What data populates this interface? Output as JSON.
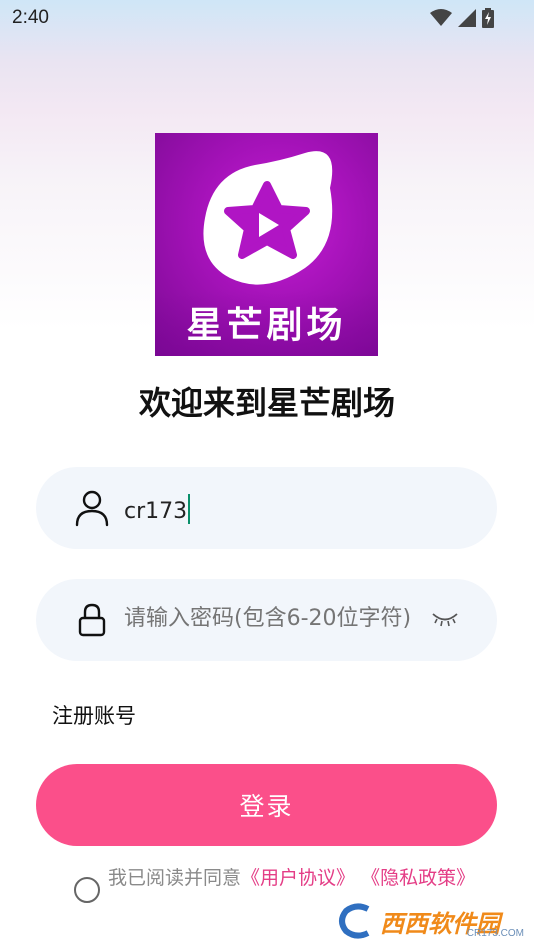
{
  "status_bar": {
    "time": "2:40",
    "icons": [
      "wifi-icon",
      "signal-icon",
      "battery-charging-icon"
    ]
  },
  "app": {
    "logo_text": "星芒剧场",
    "welcome": "欢迎来到星芒剧场",
    "brand_color": "#fb4f8a",
    "logo_color": "#a412b8"
  },
  "form": {
    "username_value": "cr173",
    "password_placeholder": "请输入密码(包含6-20位字符)",
    "register_label": "注册账号",
    "login_label": "登录"
  },
  "agreement": {
    "prefix": "我已阅读并同意",
    "user_agreement": "《用户协议》",
    "separator": " ",
    "privacy_policy": "《隐私政策》",
    "checked": false
  },
  "watermark": {
    "brand": "西西软件园",
    "site": "CR173.COM"
  }
}
